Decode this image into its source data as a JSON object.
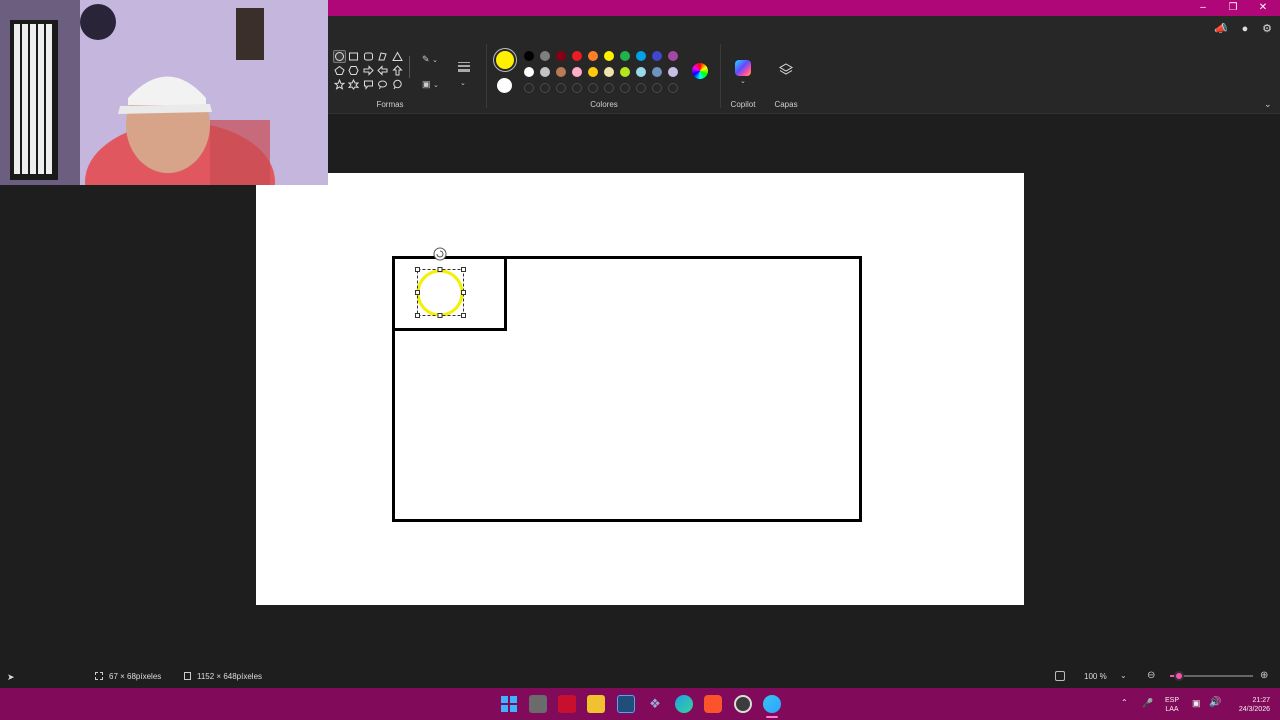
{
  "ribbon": {
    "groups": {
      "shapes": "Formas",
      "colors": "Colores",
      "copilot": "Copilot",
      "layers": "Capas"
    },
    "primary_color": "#ffef00",
    "secondary_color": "#ffffff",
    "palette_row1": [
      "#000000",
      "#7f7f7f",
      "#880015",
      "#ed1c24",
      "#ff7f27",
      "#fff200",
      "#22b14c",
      "#00a2e8",
      "#3f48cc",
      "#a349a4"
    ],
    "palette_row2": [
      "#ffffff",
      "#c3c3c3",
      "#b97a57",
      "#ffaec9",
      "#ffc90e",
      "#efe4b0",
      "#b5e61d",
      "#99d9ea",
      "#7092be",
      "#c8bfe7"
    ]
  },
  "status": {
    "selection_size": "67 × 68píxeles",
    "canvas_size": "1152 × 648píxeles",
    "zoom": "100 %"
  },
  "tray": {
    "lang_line1": "ESP",
    "lang_line2": "LAA",
    "time": "21:27",
    "date": "24/3/2026"
  },
  "canvas": {
    "shape_fill": "#ffff00"
  }
}
